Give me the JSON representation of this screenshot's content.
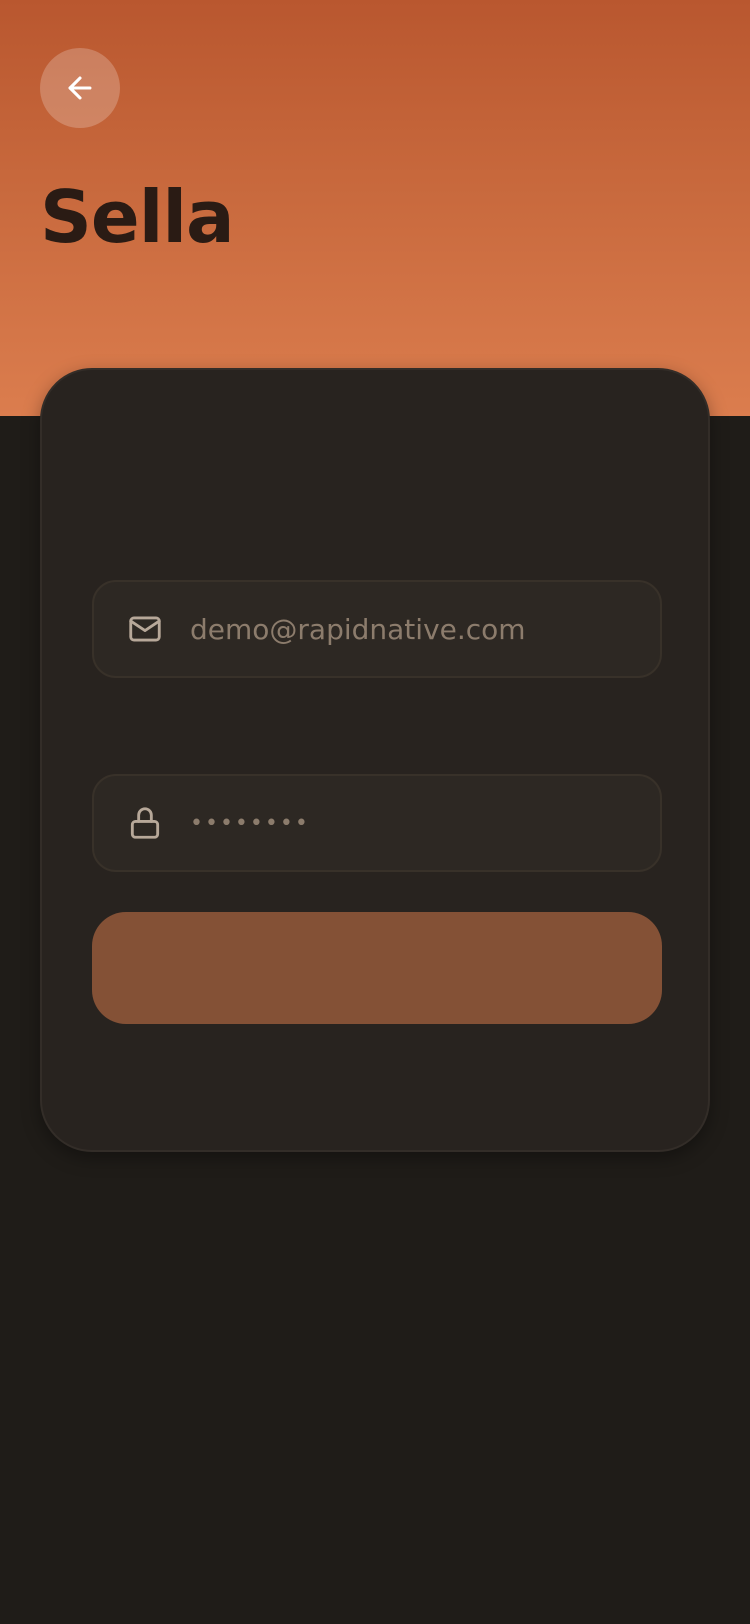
{
  "header": {
    "back_icon": "arrow-left-icon",
    "title": "Sella"
  },
  "form": {
    "email": {
      "icon": "mail-icon",
      "value": "demo@rapidnative.com"
    },
    "password": {
      "icon": "lock-icon",
      "value": "••••••••"
    },
    "submit_label": ""
  },
  "colors": {
    "header_gradient_top": "#b9572f",
    "header_gradient_bottom": "#db7d4e",
    "background": "#1f1c18",
    "card": "#28231f",
    "button": "#845136"
  }
}
